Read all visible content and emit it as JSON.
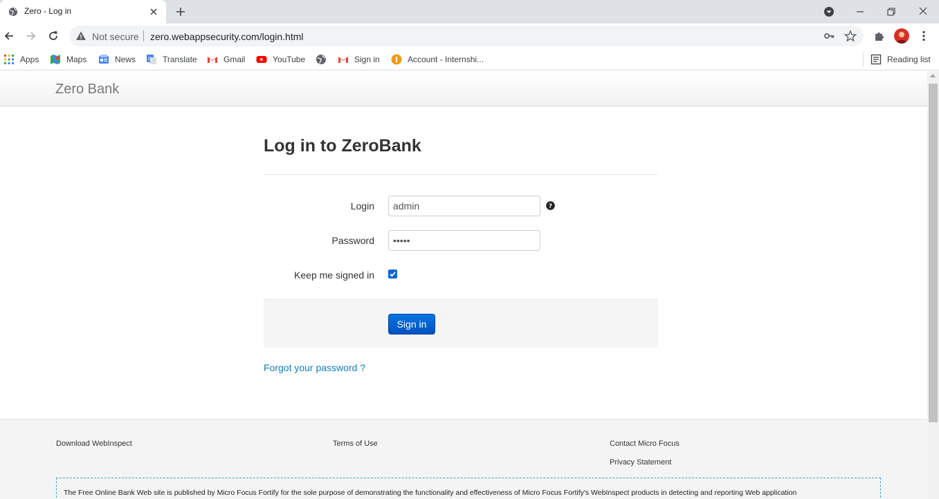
{
  "browser": {
    "tab_title": "Zero - Log in",
    "address": {
      "security_label": "Not secure",
      "url": "zero.webappsecurity.com/login.html"
    },
    "bookmarks": [
      {
        "label": "Apps",
        "icon": "apps-grid-icon"
      },
      {
        "label": "Maps",
        "icon": "maps-icon"
      },
      {
        "label": "News",
        "icon": "news-icon"
      },
      {
        "label": "Translate",
        "icon": "translate-icon"
      },
      {
        "label": "Gmail",
        "icon": "gmail-icon"
      },
      {
        "label": "YouTube",
        "icon": "youtube-icon"
      },
      {
        "label": "",
        "icon": "globe-icon"
      },
      {
        "label": "Sign in",
        "icon": "gmail-icon"
      },
      {
        "label": "Account - Internshi...",
        "icon": "internshala-icon"
      }
    ],
    "reading_list": "Reading list"
  },
  "page": {
    "brand": "Zero Bank",
    "heading": "Log in to ZeroBank",
    "form": {
      "login_label": "Login",
      "login_value": "admin",
      "password_label": "Password",
      "password_value": "•••••",
      "keep_signed_label": "Keep me signed in",
      "keep_signed_checked": true,
      "submit_label": "Sign in"
    },
    "forgot_link": "Forgot your password ?",
    "footer": {
      "links": [
        "Download WebInspect",
        "Terms of Use",
        "Contact Micro Focus",
        "Privacy Statement"
      ],
      "disclaimer": "The Free Online Bank Web site is published by Micro Focus Fortify for the sole purpose of demonstrating the functionality and effectiveness of Micro Focus Fortify's WebInspect products in detecting and reporting Web application"
    }
  },
  "colors": {
    "primary_button": "#0a76e3",
    "link": "#0f7ec2",
    "checkbox": "#0b65d6"
  }
}
